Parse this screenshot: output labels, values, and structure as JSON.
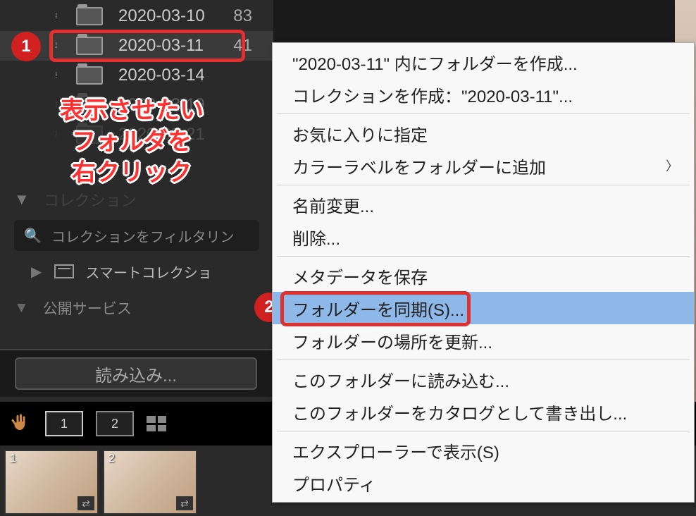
{
  "folders": [
    {
      "label": "2020-03-10",
      "count": "83",
      "selected": false
    },
    {
      "label": "2020-03-11",
      "count": "41",
      "selected": true
    },
    {
      "label": "2020-03-14",
      "count": "",
      "selected": false
    },
    {
      "label": "2020-03-19",
      "count": "",
      "selected": false
    },
    {
      "label": "2020-03-21",
      "count": "",
      "selected": false
    }
  ],
  "annotation": {
    "line1": "表示させたい",
    "line2": "フォルダを",
    "line3": "右クリック"
  },
  "steps": {
    "one": "1",
    "two": "2"
  },
  "collections": {
    "header": "コレクション",
    "filter_placeholder": "コレクションをフィルタリン",
    "smart_label": "スマートコレクショ"
  },
  "services": {
    "header": "公開サービス"
  },
  "import_button": "読み込み...",
  "view_buttons": {
    "one": "1",
    "two": "2"
  },
  "thumbnails": [
    {
      "num": "1"
    },
    {
      "num": "2"
    }
  ],
  "context_menu": {
    "items": [
      {
        "label": "\"2020-03-11\" 内にフォルダーを作成...",
        "type": "item"
      },
      {
        "label": "コレクションを作成：\"2020-03-11\"...",
        "type": "item"
      },
      {
        "type": "divider"
      },
      {
        "label": "お気に入りに指定",
        "type": "item"
      },
      {
        "label": "カラーラベルをフォルダーに追加",
        "type": "item",
        "submenu": true
      },
      {
        "type": "divider"
      },
      {
        "label": "名前変更...",
        "type": "item"
      },
      {
        "label": "削除...",
        "type": "item"
      },
      {
        "type": "divider"
      },
      {
        "label": "メタデータを保存",
        "type": "item"
      },
      {
        "label": "フォルダーを同期(S)...",
        "type": "item",
        "highlighted": true
      },
      {
        "label": "フォルダーの場所を更新...",
        "type": "item"
      },
      {
        "type": "divider"
      },
      {
        "label": "このフォルダーに読み込む...",
        "type": "item"
      },
      {
        "label": "このフォルダーをカタログとして書き出し...",
        "type": "item"
      },
      {
        "type": "divider"
      },
      {
        "label": "エクスプローラーで表示(S)",
        "type": "item"
      },
      {
        "label": "プロパティ",
        "type": "item"
      }
    ]
  }
}
